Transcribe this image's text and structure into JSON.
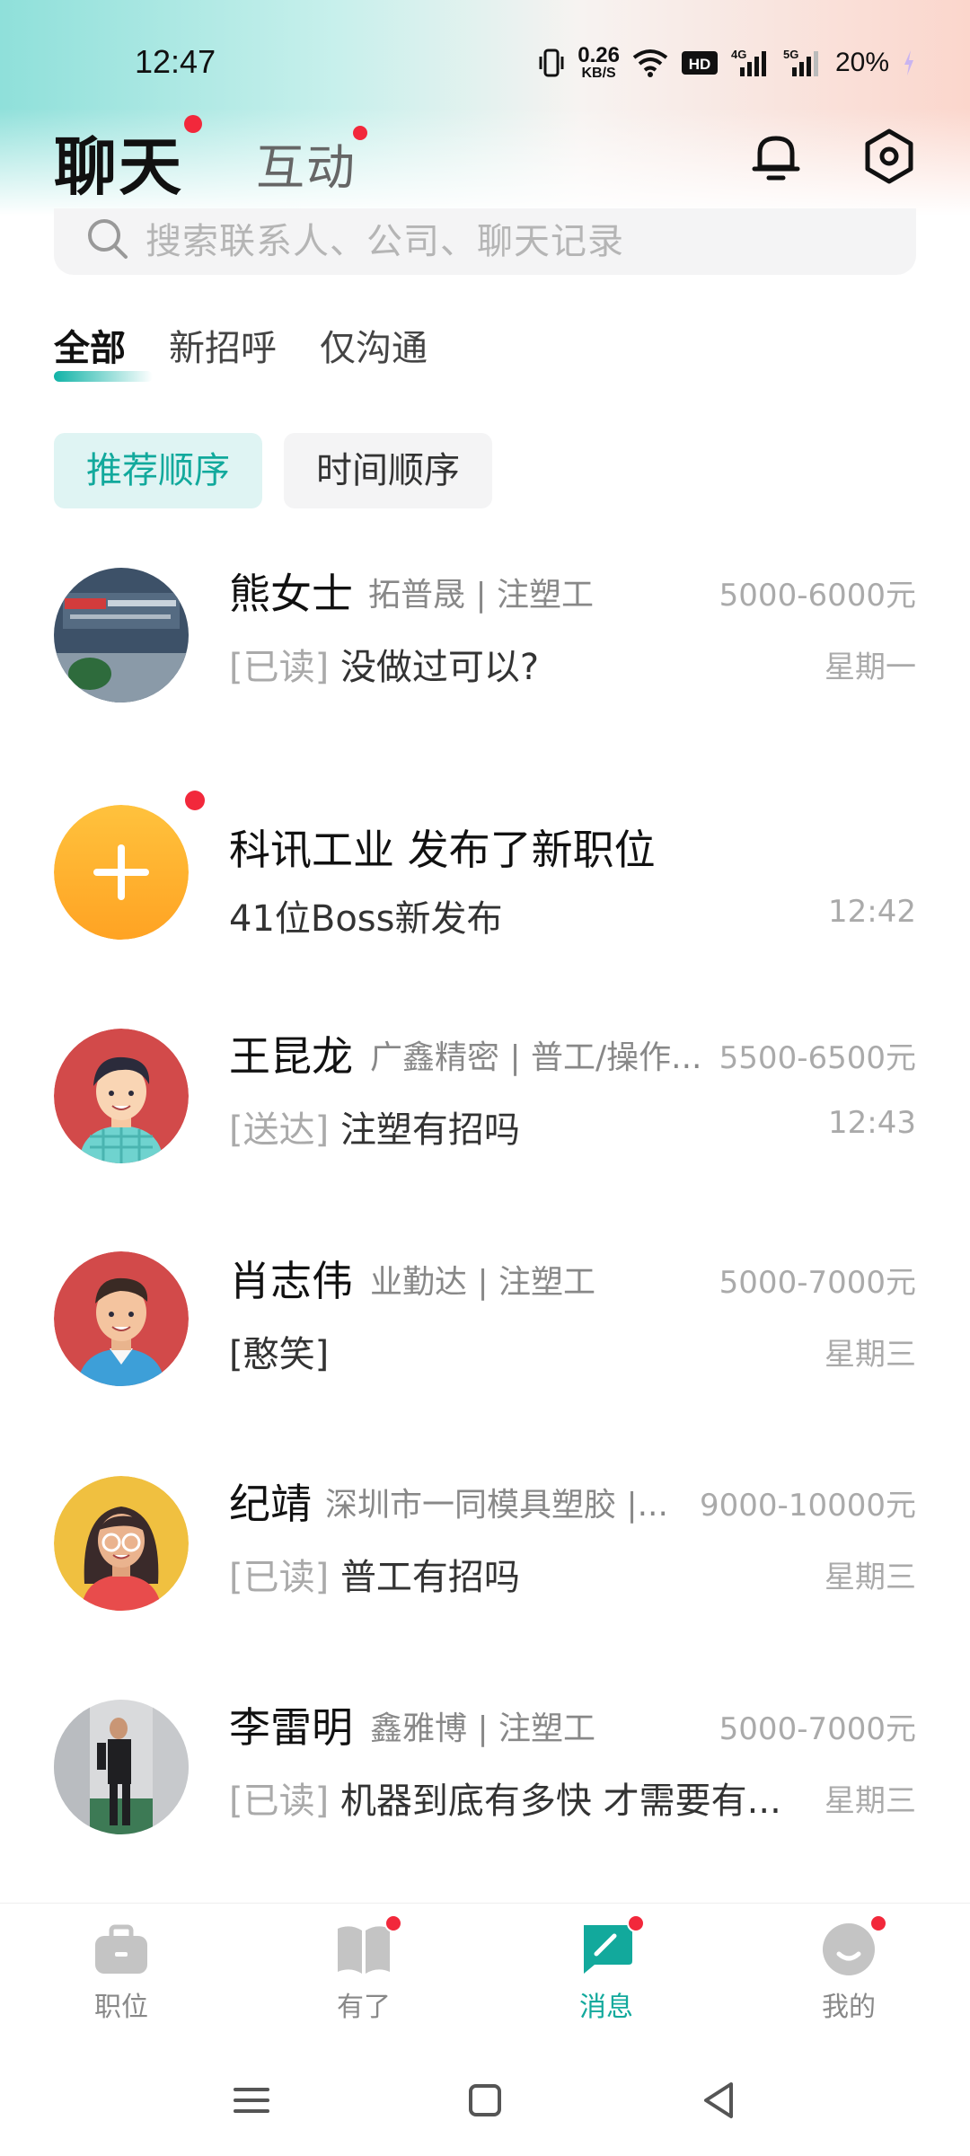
{
  "status_bar": {
    "time": "12:47",
    "net_speed_value": "0.26",
    "net_speed_unit": "KB/S",
    "hd": "HD",
    "sim1": "4G",
    "sim2": "5G",
    "battery": "20%"
  },
  "header": {
    "title": "聊天",
    "secondary_tab": "互动"
  },
  "search": {
    "placeholder": "搜索联系人、公司、聊天记录"
  },
  "filter_tabs": [
    "全部",
    "新招呼",
    "仅沟通"
  ],
  "sort_chips": [
    "推荐顺序",
    "时间顺序"
  ],
  "conversations": [
    {
      "name": "熊女士",
      "company": "拓普晟 | 注塑工",
      "salary": "5000-6000元",
      "status": "[已读]",
      "message": "没做过可以?",
      "time": "星期一"
    },
    {
      "title": "科讯工业 发布了新职位",
      "message": "41位Boss新发布",
      "time": "12:42"
    },
    {
      "name": "王昆龙",
      "company": "广鑫精密 | 普工/操作...",
      "salary": "5500-6500元",
      "status": "[送达]",
      "message": "注塑有招吗",
      "time": "12:43"
    },
    {
      "name": "肖志伟",
      "company": "业勤达 | 注塑工",
      "salary": "5000-7000元",
      "status": "",
      "message": "[憨笑]",
      "time": "星期三"
    },
    {
      "name": "纪靖",
      "company": "深圳市一同模具塑胶 |...",
      "salary": "9000-10000元",
      "status": "[已读]",
      "message": "普工有招吗",
      "time": "星期三"
    },
    {
      "name": "李雷明",
      "company": "鑫雅博 | 注塑工",
      "salary": "5000-7000元",
      "status": "[已读]",
      "message": "机器到底有多快 才需要有...",
      "time": "星期三"
    }
  ],
  "bottom_nav": [
    "职位",
    "有了",
    "消息",
    "我的"
  ],
  "colors": {
    "accent": "#12a99c",
    "badge": "#f2283b"
  }
}
